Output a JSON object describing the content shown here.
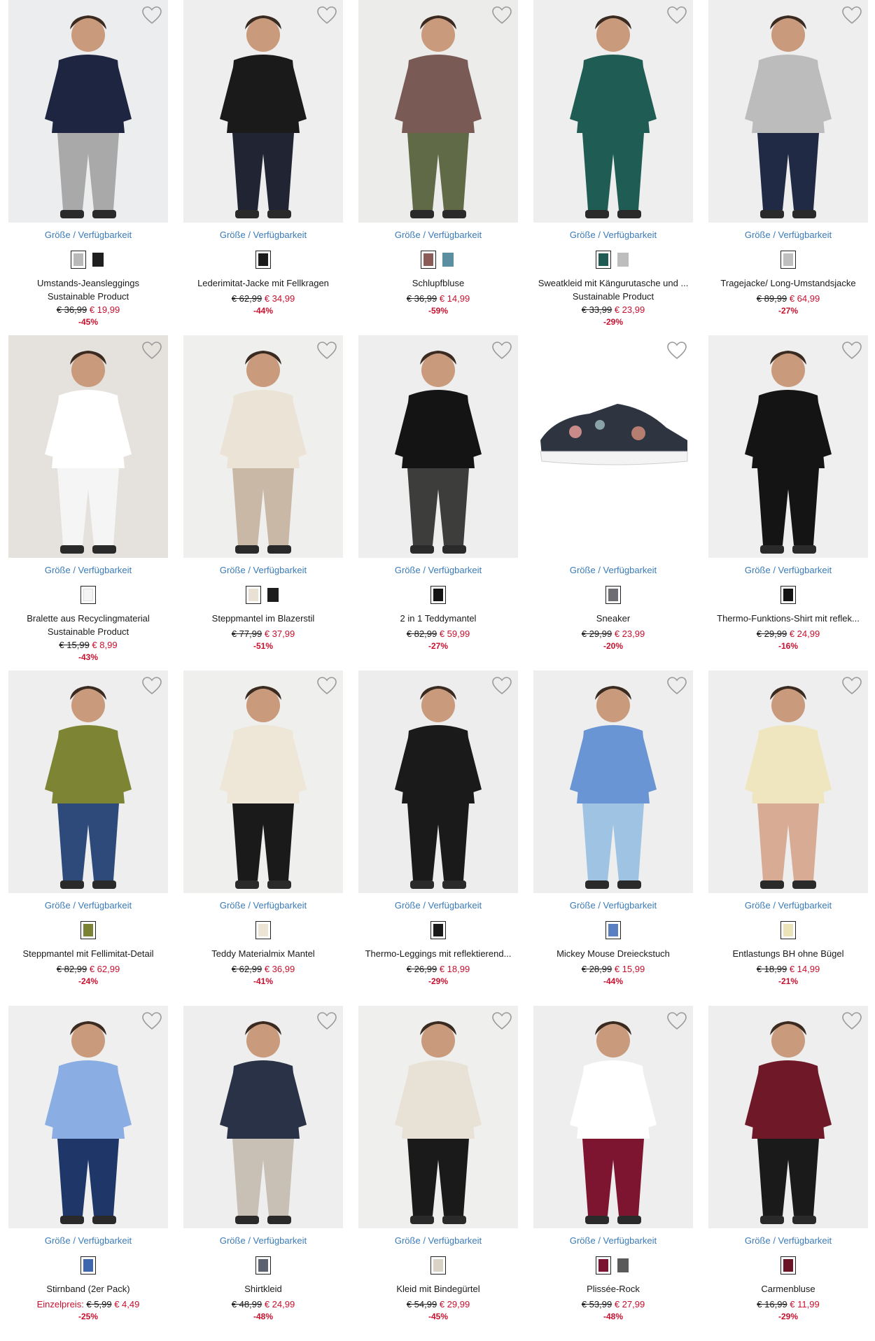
{
  "colors": {
    "accent_link": "#3a7bb8",
    "sale_red": "#c8102e",
    "image_bg": "#eceded"
  },
  "products": [
    {
      "name": "Umstands-Jeansleggings",
      "subtitle": "Sustainable Product",
      "price_old": "€ 36,99",
      "price_new": "€ 19,99",
      "discount": "-45%",
      "availability": "Größe / Verfügbarkeit",
      "swatches": [
        "#b9b9b9",
        "#1f1f1f"
      ],
      "image": {
        "bg": "#ecedee",
        "top": "#1d2540",
        "bottom": "#a9a9a9"
      }
    },
    {
      "name": "Lederimitat-Jacke mit Fellkragen",
      "subtitle": "",
      "price_old": "€ 62,99",
      "price_new": "€ 34,99",
      "discount": "-44%",
      "availability": "Größe / Verfügbarkeit",
      "swatches": [
        "#1c1c1c"
      ],
      "image": {
        "bg": "#eeeeee",
        "top": "#1a1a1a",
        "bottom": "#202433"
      }
    },
    {
      "name": "Schlupfbluse",
      "subtitle": "",
      "price_old": "€ 36,99",
      "price_new": "€ 14,99",
      "discount": "-59%",
      "availability": "Größe / Verfügbarkeit",
      "swatches": [
        "#8b5b58",
        "#5b8fa0"
      ],
      "image": {
        "bg": "#ececea",
        "top": "#7a5a55",
        "bottom": "#616a46"
      }
    },
    {
      "name": "Sweatkleid mit Kängurutasche und ...",
      "subtitle": "Sustainable Product",
      "price_old": "€ 33,99",
      "price_new": "€ 23,99",
      "discount": "-29%",
      "availability": "Größe / Verfügbarkeit",
      "swatches": [
        "#1e5b52",
        "#bdbdbd"
      ],
      "image": {
        "bg": "#edeeed",
        "top": "#1f5d54",
        "bottom": "#1f5d54"
      }
    },
    {
      "name": "Tragejacke/ Long-Umstandsjacke",
      "subtitle": "",
      "price_old": "€ 89,99",
      "price_new": "€ 64,99",
      "discount": "-27%",
      "availability": "Größe / Verfügbarkeit",
      "swatches": [
        "#bfbfbf"
      ],
      "image": {
        "bg": "#eeeeef",
        "top": "#bcbcbc",
        "bottom": "#202a45"
      }
    },
    {
      "name": "Bralette aus Recyclingmaterial",
      "subtitle": "Sustainable Product",
      "price_old": "€ 15,99",
      "price_new": "€ 8,99",
      "discount": "-43%",
      "availability": "Größe / Verfügbarkeit",
      "swatches": [
        "#f4f4f4"
      ],
      "image": {
        "bg": "#e5e2de",
        "top": "#ffffff",
        "bottom": "#f5f5f5"
      }
    },
    {
      "name": "Steppmantel im Blazerstil",
      "subtitle": "",
      "price_old": "€ 77,99",
      "price_new": "€ 37,99",
      "discount": "-51%",
      "availability": "Größe / Verfügbarkeit",
      "swatches": [
        "#e9e1d3",
        "#1d1d1d"
      ],
      "image": {
        "bg": "#efefee",
        "top": "#ebe4d6",
        "bottom": "#c9b8a6"
      }
    },
    {
      "name": "2 in 1 Teddymantel",
      "subtitle": "",
      "price_old": "€ 82,99",
      "price_new": "€ 59,99",
      "discount": "-27%",
      "availability": "Größe / Verfügbarkeit",
      "swatches": [
        "#151515"
      ],
      "image": {
        "bg": "#eeeeee",
        "top": "#141414",
        "bottom": "#3d3d3b"
      }
    },
    {
      "name": "Sneaker",
      "subtitle": "",
      "price_old": "€ 29,99",
      "price_new": "€ 23,99",
      "discount": "-20%",
      "availability": "Größe / Verfügbarkeit",
      "swatches": [
        "#6d6d73"
      ],
      "image": {
        "bg": "#ffffff",
        "top": "#2e3440",
        "bottom": "#f3f3f3"
      }
    },
    {
      "name": "Thermo-Funktions-Shirt mit reflek...",
      "subtitle": "",
      "price_old": "€ 29,99",
      "price_new": "€ 24,99",
      "discount": "-16%",
      "availability": "Größe / Verfügbarkeit",
      "swatches": [
        "#141414"
      ],
      "image": {
        "bg": "#efefef",
        "top": "#141414",
        "bottom": "#141414"
      }
    },
    {
      "name": "Steppmantel mit Fellimitat-Detail",
      "subtitle": "",
      "price_old": "€ 82,99",
      "price_new": "€ 62,99",
      "discount": "-24%",
      "availability": "Größe / Verfügbarkeit",
      "swatches": [
        "#7b8234"
      ],
      "image": {
        "bg": "#eeeeee",
        "top": "#7d8535",
        "bottom": "#2d4a7a"
      }
    },
    {
      "name": "Teddy Materialmix Mantel",
      "subtitle": "",
      "price_old": "€ 62,99",
      "price_new": "€ 36,99",
      "discount": "-41%",
      "availability": "Größe / Verfügbarkeit",
      "swatches": [
        "#ece5d6"
      ],
      "image": {
        "bg": "#efefee",
        "top": "#eee6d6",
        "bottom": "#1a1a1a"
      }
    },
    {
      "name": "Thermo-Leggings mit reflektierend...",
      "subtitle": "",
      "price_old": "€ 26,99",
      "price_new": "€ 18,99",
      "discount": "-29%",
      "availability": "Größe / Verfügbarkeit",
      "swatches": [
        "#1a1a1a"
      ],
      "image": {
        "bg": "#ededed",
        "top": "#1a1a1a",
        "bottom": "#1a1a1a"
      }
    },
    {
      "name": "Mickey Mouse Dreieckstuch",
      "subtitle": "",
      "price_old": "€ 28,99",
      "price_new": "€ 15,99",
      "discount": "-44%",
      "availability": "Größe / Verfügbarkeit",
      "swatches": [
        "#5a7fc2"
      ],
      "image": {
        "bg": "#eeeeee",
        "top": "#6a95d4",
        "bottom": "#9ec3e3"
      }
    },
    {
      "name": "Entlastungs BH ohne Bügel",
      "subtitle": "",
      "price_old": "€ 18,99",
      "price_new": "€ 14,99",
      "discount": "-21%",
      "availability": "Größe / Verfügbarkeit",
      "swatches": [
        "#ece3b8"
      ],
      "image": {
        "bg": "#eeeeee",
        "top": "#efe6bf",
        "bottom": "#d7ab94"
      }
    },
    {
      "name": "Stirnband (2er Pack)",
      "subtitle": "",
      "price_prefix": "Einzelpreis:",
      "price_old": "€ 5,99",
      "price_new": "€ 4,49",
      "discount": "-25%",
      "availability": "Größe / Verfügbarkeit",
      "swatches": [
        "#3d66b1"
      ],
      "image": {
        "bg": "#efefef",
        "top": "#8aaee3",
        "bottom": "#1f3768"
      }
    },
    {
      "name": "Shirtkleid",
      "subtitle": "",
      "price_old": "€ 48,99",
      "price_new": "€ 24,99",
      "discount": "-48%",
      "availability": "Größe / Verfügbarkeit",
      "swatches": [
        "#5c6270"
      ],
      "image": {
        "bg": "#eeeeee",
        "top": "#2a3248",
        "bottom": "#c8bfb5"
      }
    },
    {
      "name": "Kleid mit Bindegürtel",
      "subtitle": "",
      "price_old": "€ 54,99",
      "price_new": "€ 29,99",
      "discount": "-45%",
      "availability": "Größe / Verfügbarkeit",
      "swatches": [
        "#d9d2c5"
      ],
      "image": {
        "bg": "#efefee",
        "top": "#e8e1d5",
        "bottom": "#1a1a1a"
      }
    },
    {
      "name": "Plissée-Rock",
      "subtitle": "",
      "price_old": "€ 53,99",
      "price_new": "€ 27,99",
      "discount": "-48%",
      "availability": "Größe / Verfügbarkeit",
      "swatches": [
        "#7a1430",
        "#5a5a5a"
      ],
      "image": {
        "bg": "#eeeeee",
        "top": "#ffffff",
        "bottom": "#7d1430"
      }
    },
    {
      "name": "Carmenbluse",
      "subtitle": "",
      "price_old": "€ 16,99",
      "price_new": "€ 11,99",
      "discount": "-29%",
      "availability": "Größe / Verfügbarkeit",
      "swatches": [
        "#6a1426"
      ],
      "image": {
        "bg": "#eeeeee",
        "top": "#6e1828",
        "bottom": "#1a1a1a"
      }
    }
  ]
}
